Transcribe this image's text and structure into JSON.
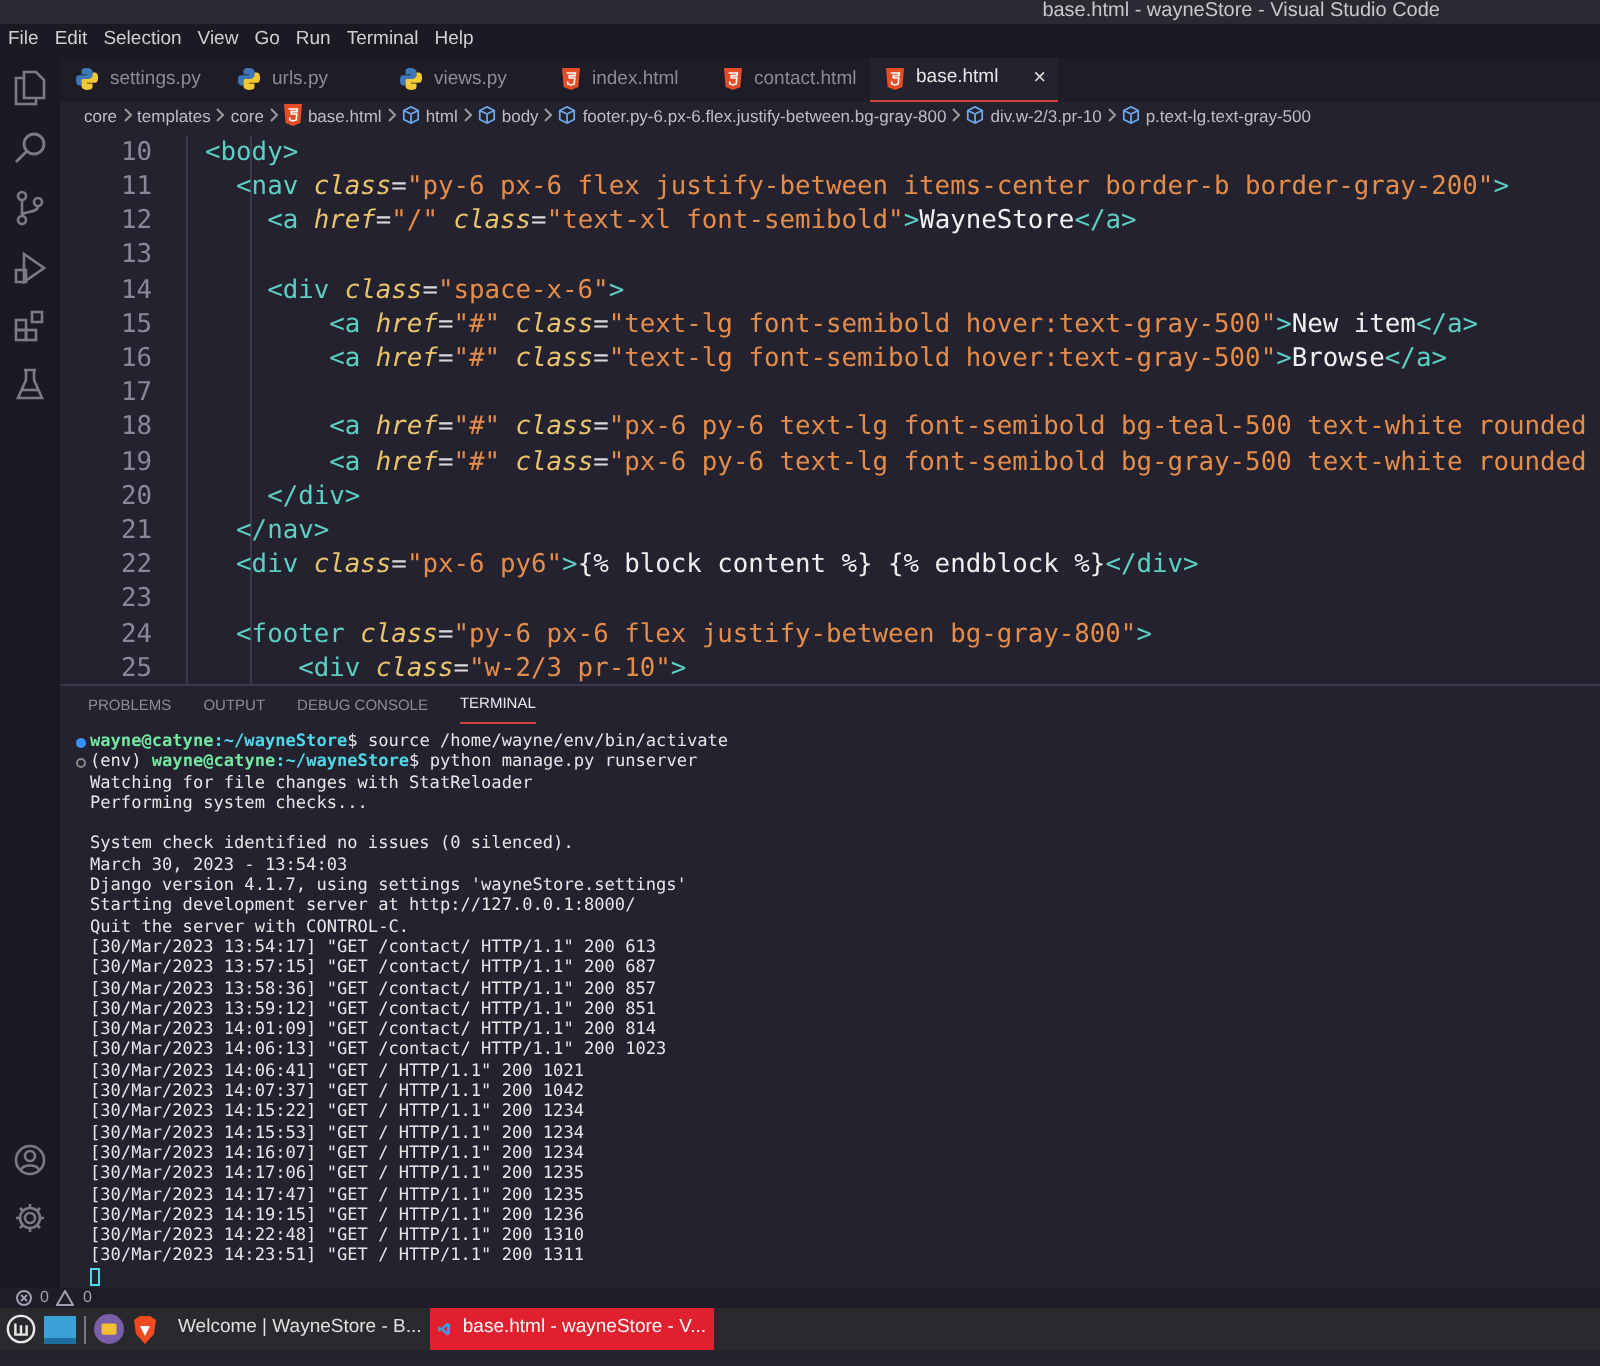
{
  "window": {
    "title": "base.html - wayneStore - Visual Studio Code"
  },
  "menu": [
    "File",
    "Edit",
    "Selection",
    "View",
    "Go",
    "Run",
    "Terminal",
    "Help"
  ],
  "tabs": [
    {
      "label": "settings.py",
      "kind": "python",
      "selected": false
    },
    {
      "label": "urls.py",
      "kind": "python",
      "selected": false
    },
    {
      "label": "views.py",
      "kind": "python",
      "selected": false
    },
    {
      "label": "index.html",
      "kind": "html",
      "selected": false
    },
    {
      "label": "contact.html",
      "kind": "html",
      "selected": false
    },
    {
      "label": "base.html",
      "kind": "html",
      "selected": true,
      "close": "×"
    }
  ],
  "breadcrumb": [
    {
      "label": "core",
      "kind": "folder"
    },
    {
      "label": "templates",
      "kind": "folder"
    },
    {
      "label": "core",
      "kind": "folder"
    },
    {
      "label": "base.html",
      "kind": "html"
    },
    {
      "label": "html",
      "kind": "element"
    },
    {
      "label": "body",
      "kind": "element"
    },
    {
      "label": "footer.py-6.px-6.flex.justify-between.bg-gray-800",
      "kind": "element"
    },
    {
      "label": "div.w-2/3.pr-10",
      "kind": "element"
    },
    {
      "label": "p.text-lg.text-gray-500",
      "kind": "element"
    }
  ],
  "code": [
    {
      "number": "10",
      "tokens": [
        {
          "kind": "tag",
          "text": "  <body>"
        }
      ]
    },
    {
      "number": "11",
      "tokens": [
        {
          "kind": "tag",
          "text": "    <nav"
        },
        {
          "kind": "attr",
          "text": " class"
        },
        {
          "kind": "eq",
          "text": "="
        },
        {
          "kind": "str",
          "text": "\"py-6 px-6 flex justify-between items-center border-b border-gray-200\""
        },
        {
          "kind": "tag",
          "text": ">"
        }
      ]
    },
    {
      "number": "12",
      "tokens": [
        {
          "kind": "tag",
          "text": "      <a"
        },
        {
          "kind": "attr",
          "text": " href"
        },
        {
          "kind": "eq",
          "text": "="
        },
        {
          "kind": "str",
          "text": "\"/\""
        },
        {
          "kind": "attr",
          "text": " class"
        },
        {
          "kind": "eq",
          "text": "="
        },
        {
          "kind": "str",
          "text": "\"text-xl font-semibold\""
        },
        {
          "kind": "tag",
          "text": ">"
        },
        {
          "kind": "text",
          "text": "WayneStore"
        },
        {
          "kind": "tag",
          "text": "</a>"
        }
      ]
    },
    {
      "number": "13"
    },
    {
      "number": "14",
      "tokens": [
        {
          "kind": "tag",
          "text": "      <div"
        },
        {
          "kind": "attr",
          "text": " class"
        },
        {
          "kind": "eq",
          "text": "="
        },
        {
          "kind": "str",
          "text": "\"space-x-6\""
        },
        {
          "kind": "tag",
          "text": ">"
        }
      ]
    },
    {
      "number": "15",
      "tokens": [
        {
          "kind": "tag",
          "text": "          <a"
        },
        {
          "kind": "attr",
          "text": " href"
        },
        {
          "kind": "eq",
          "text": "="
        },
        {
          "kind": "str",
          "text": "\"#\""
        },
        {
          "kind": "attr",
          "text": " class"
        },
        {
          "kind": "eq",
          "text": "="
        },
        {
          "kind": "str",
          "text": "\"text-lg font-semibold hover:text-gray-500\""
        },
        {
          "kind": "tag",
          "text": ">"
        },
        {
          "kind": "text",
          "text": "New item"
        },
        {
          "kind": "tag",
          "text": "</a>"
        }
      ]
    },
    {
      "number": "16",
      "tokens": [
        {
          "kind": "tag",
          "text": "          <a"
        },
        {
          "kind": "attr",
          "text": " href"
        },
        {
          "kind": "eq",
          "text": "="
        },
        {
          "kind": "str",
          "text": "\"#\""
        },
        {
          "kind": "attr",
          "text": " class"
        },
        {
          "kind": "eq",
          "text": "="
        },
        {
          "kind": "str",
          "text": "\"text-lg font-semibold hover:text-gray-500\""
        },
        {
          "kind": "tag",
          "text": ">"
        },
        {
          "kind": "text",
          "text": "Browse"
        },
        {
          "kind": "tag",
          "text": "</a>"
        }
      ]
    },
    {
      "number": "17"
    },
    {
      "number": "18",
      "tokens": [
        {
          "kind": "tag",
          "text": "          <a"
        },
        {
          "kind": "attr",
          "text": " href"
        },
        {
          "kind": "eq",
          "text": "="
        },
        {
          "kind": "str",
          "text": "\"#\""
        },
        {
          "kind": "attr",
          "text": " class"
        },
        {
          "kind": "eq",
          "text": "="
        },
        {
          "kind": "str",
          "text": "\"px-6 py-6 text-lg font-semibold bg-teal-500 text-white rounded"
        }
      ]
    },
    {
      "number": "19",
      "tokens": [
        {
          "kind": "tag",
          "text": "          <a"
        },
        {
          "kind": "attr",
          "text": " href"
        },
        {
          "kind": "eq",
          "text": "="
        },
        {
          "kind": "str",
          "text": "\"#\""
        },
        {
          "kind": "attr",
          "text": " class"
        },
        {
          "kind": "eq",
          "text": "="
        },
        {
          "kind": "str",
          "text": "\"px-6 py-6 text-lg font-semibold bg-gray-500 text-white rounded"
        }
      ]
    },
    {
      "number": "20",
      "tokens": [
        {
          "kind": "tag",
          "text": "      </div>"
        }
      ]
    },
    {
      "number": "21",
      "tokens": [
        {
          "kind": "tag",
          "text": "    </nav>"
        }
      ]
    },
    {
      "number": "22",
      "tokens": [
        {
          "kind": "tag",
          "text": "    <div"
        },
        {
          "kind": "attr",
          "text": " class"
        },
        {
          "kind": "eq",
          "text": "="
        },
        {
          "kind": "str",
          "text": "\"px-6 py6\""
        },
        {
          "kind": "tag",
          "text": ">"
        },
        {
          "kind": "text",
          "text": "{% block content %} {% endblock %}"
        },
        {
          "kind": "tag",
          "text": "</div>"
        }
      ]
    },
    {
      "number": "23"
    },
    {
      "number": "24",
      "tokens": [
        {
          "kind": "tag",
          "text": "    <footer"
        },
        {
          "kind": "attr",
          "text": " class"
        },
        {
          "kind": "eq",
          "text": "="
        },
        {
          "kind": "str",
          "text": "\"py-6 px-6 flex justify-between bg-gray-800\""
        },
        {
          "kind": "tag",
          "text": ">"
        }
      ]
    },
    {
      "number": "25",
      "tokens": [
        {
          "kind": "tag",
          "text": "        <div"
        },
        {
          "kind": "attr",
          "text": " class"
        },
        {
          "kind": "eq",
          "text": "="
        },
        {
          "kind": "str",
          "text": "\"w-2/3 pr-10\""
        },
        {
          "kind": "tag",
          "text": ">"
        }
      ]
    }
  ],
  "panel_tabs": [
    {
      "label": "PROBLEMS",
      "selected": false
    },
    {
      "label": "OUTPUT",
      "selected": false
    },
    {
      "label": "DEBUG CONSOLE",
      "selected": false
    },
    {
      "label": "TERMINAL",
      "selected": true
    }
  ],
  "terminal": [
    {
      "kind": "command",
      "finished": true,
      "user": "wayne@catyne",
      "path": ":~/wayneStore",
      "symbol": "$",
      "command": "source /home/wayne/env/bin/activate"
    },
    {
      "kind": "command",
      "finished": false,
      "prefix": "(env)",
      "user": "wayne@catyne",
      "path": ":~/wayneStore",
      "symbol": "$",
      "command": "python manage.py runserver"
    },
    {
      "kind": "output",
      "text": "Watching for file changes with StatReloader"
    },
    {
      "kind": "output",
      "text": "Performing system checks..."
    },
    {
      "kind": "blank"
    },
    {
      "kind": "output",
      "text": "System check identified no issues (0 silenced)."
    },
    {
      "kind": "output",
      "text": "March 30, 2023 - 13:54:03"
    },
    {
      "kind": "output",
      "text": "Django version 4.1.7, using settings 'wayneStore.settings'"
    },
    {
      "kind": "output",
      "text": "Starting development server at http://127.0.0.1:8000/"
    },
    {
      "kind": "output",
      "text": "Quit the server with CONTROL-C."
    },
    {
      "kind": "output",
      "text": "[30/Mar/2023 13:54:17] \"GET /contact/ HTTP/1.1\" 200 613"
    },
    {
      "kind": "output",
      "text": "[30/Mar/2023 13:57:15] \"GET /contact/ HTTP/1.1\" 200 687"
    },
    {
      "kind": "output",
      "text": "[30/Mar/2023 13:58:36] \"GET /contact/ HTTP/1.1\" 200 857"
    },
    {
      "kind": "output",
      "text": "[30/Mar/2023 13:59:12] \"GET /contact/ HTTP/1.1\" 200 851"
    },
    {
      "kind": "output",
      "text": "[30/Mar/2023 14:01:09] \"GET /contact/ HTTP/1.1\" 200 814"
    },
    {
      "kind": "output",
      "text": "[30/Mar/2023 14:06:13] \"GET /contact/ HTTP/1.1\" 200 1023"
    },
    {
      "kind": "output",
      "text": "[30/Mar/2023 14:06:41] \"GET / HTTP/1.1\" 200 1021"
    },
    {
      "kind": "output",
      "text": "[30/Mar/2023 14:07:37] \"GET / HTTP/1.1\" 200 1042"
    },
    {
      "kind": "output",
      "text": "[30/Mar/2023 14:15:22] \"GET / HTTP/1.1\" 200 1234"
    },
    {
      "kind": "output",
      "text": "[30/Mar/2023 14:15:53] \"GET / HTTP/1.1\" 200 1234"
    },
    {
      "kind": "output",
      "text": "[30/Mar/2023 14:16:07] \"GET / HTTP/1.1\" 200 1234"
    },
    {
      "kind": "output",
      "text": "[30/Mar/2023 14:17:06] \"GET / HTTP/1.1\" 200 1235"
    },
    {
      "kind": "output",
      "text": "[30/Mar/2023 14:17:47] \"GET / HTTP/1.1\" 200 1235"
    },
    {
      "kind": "output",
      "text": "[30/Mar/2023 14:19:15] \"GET / HTTP/1.1\" 200 1236"
    },
    {
      "kind": "output",
      "text": "[30/Mar/2023 14:22:48] \"GET / HTTP/1.1\" 200 1310"
    },
    {
      "kind": "output",
      "text": "[30/Mar/2023 14:23:51] \"GET / HTTP/1.1\" 200 1311"
    },
    {
      "kind": "cursor"
    }
  ],
  "status_bar": {
    "errors": "0",
    "warnings": "0"
  },
  "taskbar": {
    "windows": [
      {
        "label": "Welcome | WayneStore - B...",
        "kind": "browser",
        "selected": false
      },
      {
        "label": "base.html - wayneStore - V...",
        "kind": "editor",
        "selected": true
      }
    ]
  }
}
